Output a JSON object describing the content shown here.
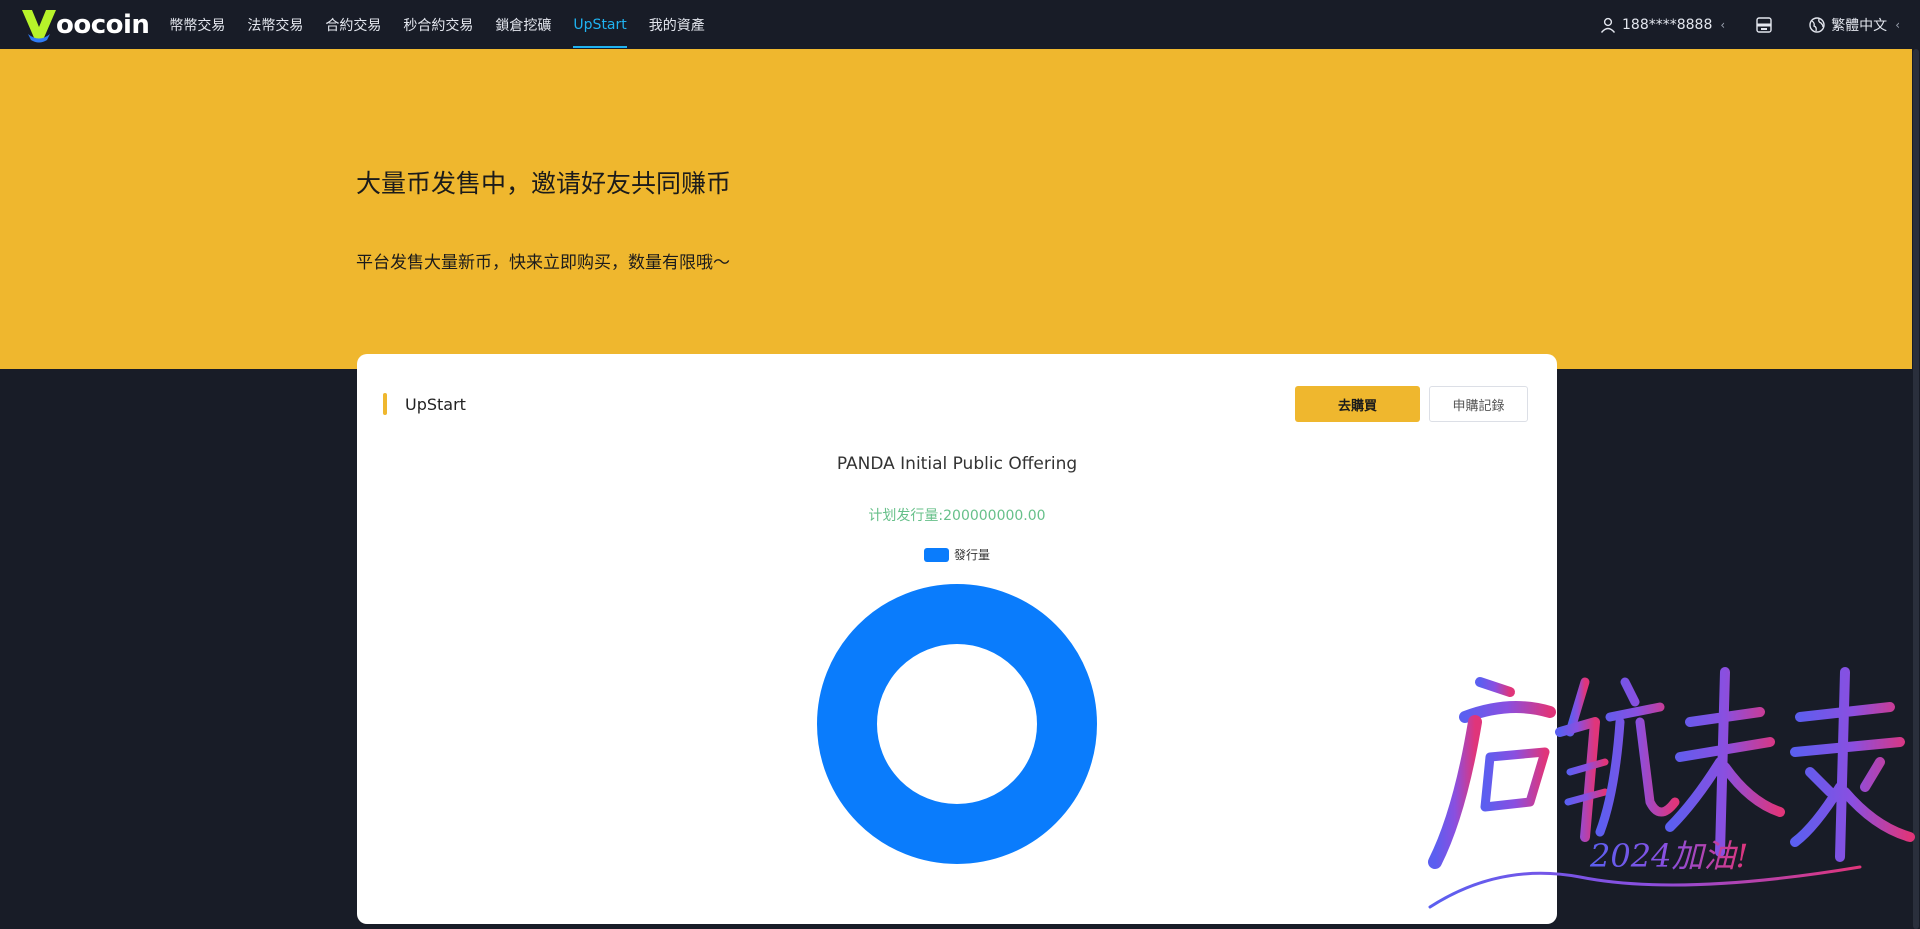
{
  "nav": {
    "logo_text": "oocoin",
    "items": [
      {
        "label": "幣幣交易",
        "active": false
      },
      {
        "label": "法幣交易",
        "active": false
      },
      {
        "label": "合約交易",
        "active": false
      },
      {
        "label": "秒合約交易",
        "active": false
      },
      {
        "label": "鎖倉挖礦",
        "active": false
      },
      {
        "label": "UpStart",
        "active": true
      },
      {
        "label": "我的資產",
        "active": false
      }
    ],
    "user": "188****8888",
    "language": "繁體中文",
    "icons": {
      "user": "user-icon",
      "download": "download-icon",
      "globe": "globe-icon"
    }
  },
  "banner": {
    "title": "大量币发售中，邀请好友共同赚币",
    "subtitle": "平台发售大量新币，快来立即购买，数量有限哦～"
  },
  "card": {
    "title": "UpStart",
    "buy_button": "去購買",
    "record_button": "申購記錄"
  },
  "chart_data": {
    "type": "pie",
    "title": "PANDA Initial Public Offering",
    "subtitle": "计划发行量:200000000.00",
    "categories": [
      "發行量"
    ],
    "values": [
      200000000
    ],
    "legend": "top-center",
    "colors": [
      "#0a7cfc"
    ]
  },
  "watermark": {
    "text": "启航未来",
    "subtext": "2024加油!"
  },
  "colors": {
    "nav_bg": "#181c27",
    "accent": "#efb72e",
    "active_nav": "#1fb2f0",
    "chart_blue": "#0a7cfc",
    "subtitle_green": "#67c08a"
  }
}
